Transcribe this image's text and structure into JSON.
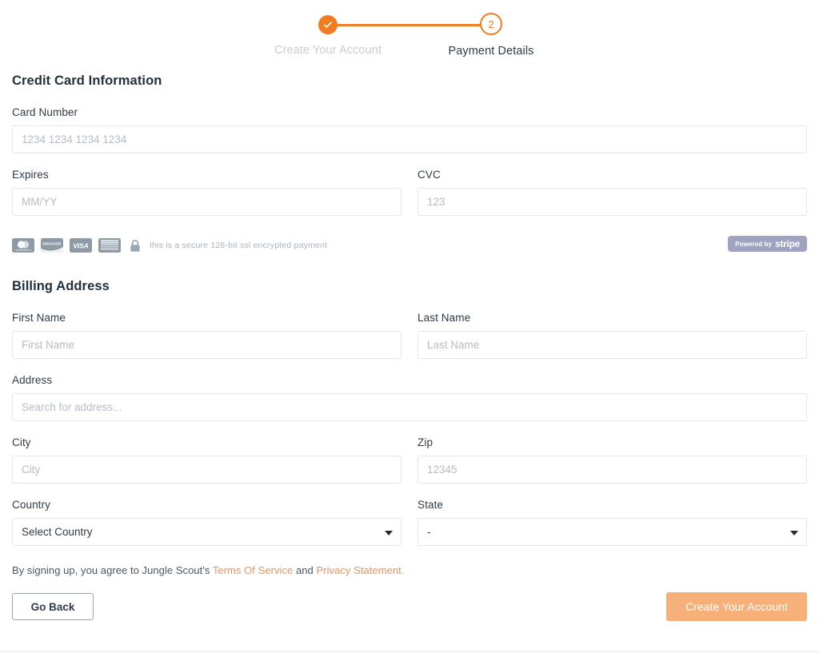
{
  "stepper": {
    "steps": [
      {
        "label": "Create Your Account",
        "marker": "check-icon",
        "state": "done"
      },
      {
        "label": "Payment Details",
        "marker": "2",
        "state": "current"
      }
    ]
  },
  "credit_card": {
    "section_title": "Credit Card Information",
    "card_number": {
      "label": "Card Number",
      "placeholder": "1234 1234 1234 1234",
      "value": ""
    },
    "expires": {
      "label": "Expires",
      "placeholder": "MM/YY",
      "value": ""
    },
    "cvc": {
      "label": "CVC",
      "placeholder": "123",
      "value": ""
    }
  },
  "secure": {
    "cards": [
      "mastercard",
      "discover",
      "visa",
      "amex"
    ],
    "card_labels": {
      "discover": "DISCOVER",
      "visa": "VISA",
      "amex": "AMERICAN EXPRESS"
    },
    "lock_icon": "lock-icon",
    "text": "this is a secure 128-bit ssl encrypted payment",
    "stripe": {
      "prefix": "Powered by",
      "name": "stripe"
    }
  },
  "billing": {
    "section_title": "Billing Address",
    "first_name": {
      "label": "First Name",
      "placeholder": "First Name",
      "value": ""
    },
    "last_name": {
      "label": "Last Name",
      "placeholder": "Last Name",
      "value": ""
    },
    "address": {
      "label": "Address",
      "placeholder": "Search for address...",
      "value": ""
    },
    "city": {
      "label": "City",
      "placeholder": "City",
      "value": ""
    },
    "zip": {
      "label": "Zip",
      "placeholder": "12345",
      "value": ""
    },
    "country": {
      "label": "Country",
      "selected": "Select Country"
    },
    "state": {
      "label": "State",
      "selected": "-"
    }
  },
  "legal": {
    "prefix": "By signing up, you agree to Jungle Scout's ",
    "terms_link": "Terms Of Service",
    "middle": " and ",
    "privacy_link": "Privacy Statement.",
    "link_color": "#f3915a"
  },
  "buttons": {
    "back": "Go Back",
    "submit": "Create Your Account",
    "submit_color": "#f6b17a"
  },
  "colors": {
    "accent": "#f07d20",
    "text": "#2e3b48",
    "muted": "#b4bcc6",
    "border": "#e2e6ea"
  }
}
